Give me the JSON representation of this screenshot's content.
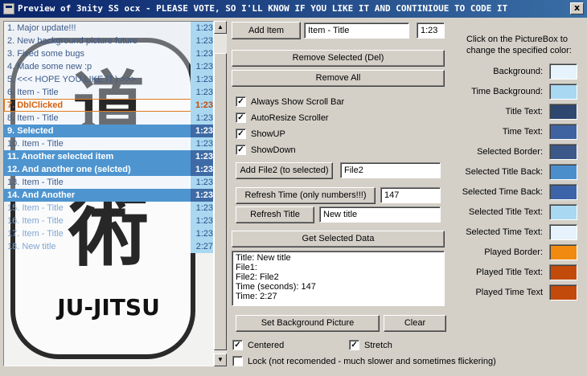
{
  "window": {
    "title": "Preview of 3nity SS ocx -  PLEASE VOTE, SO I'LL KNOW IF YOU LIKE IT AND CONTINIOUE TO CODE IT",
    "close": "x"
  },
  "background_text": {
    "top": "道",
    "middle": "術",
    "bottom": "JU-JITSU"
  },
  "list": {
    "rows": [
      {
        "title": "1. Major update!!!",
        "time": "1:23",
        "state": "norm"
      },
      {
        "title": "2.      New background picture future",
        "time": "1:23",
        "state": "norm"
      },
      {
        "title": "3.      Fixed some bugs",
        "time": "1:23",
        "state": "norm"
      },
      {
        "title": "4.      Made some new :p",
        "time": "1:23",
        "state": "norm"
      },
      {
        "title": "5.              <<<  HOPE YOU LIKE IT:)  >>>",
        "time": "1:23",
        "state": "norm"
      },
      {
        "title": "6. Item - Title",
        "time": "1:23",
        "state": "norm"
      },
      {
        "title": "7. DblClicked",
        "time": "1:23",
        "state": "dbl"
      },
      {
        "title": "8. Item - Title",
        "time": "1:23",
        "state": "norm"
      },
      {
        "title": "9. Selected",
        "time": "1:23",
        "state": "sel"
      },
      {
        "title": "10. Item - Title",
        "time": "1:23",
        "state": "norm"
      },
      {
        "title": "11. Another selected item",
        "time": "1:23",
        "state": "sel"
      },
      {
        "title": "12. And another one (selcted)",
        "time": "1:23",
        "state": "sel"
      },
      {
        "title": "13. Item - Title",
        "time": "1:23",
        "state": "norm"
      },
      {
        "title": "14. And Another",
        "time": "1:23",
        "state": "sel"
      },
      {
        "title": "15. Item - Title",
        "time": "1:23",
        "state": "played"
      },
      {
        "title": "16. Item - Title",
        "time": "1:23",
        "state": "played"
      },
      {
        "title": "17. Item - Title",
        "time": "1:23",
        "state": "played"
      },
      {
        "title": "18. New title",
        "time": "2:27",
        "state": "played"
      }
    ]
  },
  "controls": {
    "add_item": "Add Item",
    "item_title_value": "Item - Title",
    "item_time_value": "1:23",
    "remove_selected": "Remove Selected (Del)",
    "remove_all": "Remove All",
    "always_show_scroll": "Always Show Scroll Bar",
    "auto_resize": "AutoResize Scroller",
    "show_up": "ShowUP",
    "show_down": "ShowDown",
    "add_file2": "Add File2 (to selected)",
    "file2_value": "File2",
    "refresh_time": "Refresh Time (only numbers!!!)",
    "time_value": "147",
    "refresh_title": "Refresh Title",
    "new_title_value": "New title",
    "get_selected": "Get Selected Data",
    "memo": [
      "Title: New title",
      "File1:",
      "File2: File2",
      "Time (seconds): 147",
      "Time: 2:27"
    ],
    "set_bg": "Set Background Picture",
    "clear": "Clear",
    "centered": "Centered",
    "stretch": "Stretch",
    "lock": "Lock (not recomended - much slower and sometimes flickering)"
  },
  "colors": {
    "help": "Click on the PictureBox to change the specified color:",
    "items": [
      {
        "label": "Background:",
        "color": "#e6f3fc"
      },
      {
        "label": "Time Background:",
        "color": "#a9d8f2"
      },
      {
        "label": "Title Text:",
        "color": "#2e4770"
      },
      {
        "label": "Time Text:",
        "color": "#3f63a0"
      },
      {
        "label": "Selected Border:",
        "color": "#3b5888"
      },
      {
        "label": "Selected Title Back:",
        "color": "#4a8fcc"
      },
      {
        "label": "Selected Time Back:",
        "color": "#3d64a8"
      },
      {
        "label": "Selected Title Text:",
        "color": "#a9d8f2"
      },
      {
        "label": "Selected Time Text:",
        "color": "#e6f3fc"
      },
      {
        "label": "Played Border:",
        "color": "#f08a10"
      },
      {
        "label": "Played Title Text:",
        "color": "#c24a0a"
      },
      {
        "label": "Played Time Text",
        "color": "#c24a0a"
      }
    ]
  }
}
